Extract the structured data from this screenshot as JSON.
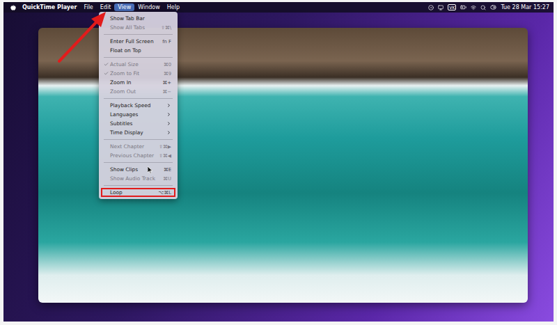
{
  "menubar": {
    "app": "QuickTime Player",
    "menus": [
      {
        "label": "File",
        "selected": false,
        "annotated": false
      },
      {
        "label": "Edit",
        "selected": false,
        "annotated": false
      },
      {
        "label": "View",
        "selected": true,
        "annotated": true
      },
      {
        "label": "Window",
        "selected": false,
        "annotated": false
      },
      {
        "label": "Help",
        "selected": false,
        "annotated": false
      }
    ],
    "input_source": "VK",
    "clock": "Tue 28 Mar 15:27"
  },
  "menu": {
    "items": [
      {
        "kind": "item",
        "label": "Show Tab Bar",
        "shortcut": "",
        "checked": false,
        "disabled": false,
        "submenu": false,
        "annotated": false
      },
      {
        "kind": "item",
        "label": "Show All Tabs",
        "shortcut": "⇧⌘\\",
        "checked": false,
        "disabled": true,
        "submenu": false,
        "annotated": false
      },
      {
        "kind": "separator"
      },
      {
        "kind": "item",
        "label": "Enter Full Screen",
        "shortcut": "fn F",
        "checked": false,
        "disabled": false,
        "submenu": false,
        "annotated": false
      },
      {
        "kind": "item",
        "label": "Float on Top",
        "shortcut": "",
        "checked": false,
        "disabled": false,
        "submenu": false,
        "annotated": false
      },
      {
        "kind": "separator"
      },
      {
        "kind": "item",
        "label": "Actual Size",
        "shortcut": "⌘0",
        "checked": true,
        "disabled": true,
        "submenu": false,
        "annotated": false
      },
      {
        "kind": "item",
        "label": "Zoom to Fit",
        "shortcut": "⌘9",
        "checked": true,
        "disabled": true,
        "submenu": false,
        "annotated": false
      },
      {
        "kind": "item",
        "label": "Zoom In",
        "shortcut": "⌘+",
        "checked": false,
        "disabled": false,
        "submenu": false,
        "annotated": false
      },
      {
        "kind": "item",
        "label": "Zoom Out",
        "shortcut": "⌘−",
        "checked": false,
        "disabled": true,
        "submenu": false,
        "annotated": false
      },
      {
        "kind": "separator"
      },
      {
        "kind": "item",
        "label": "Playback Speed",
        "shortcut": "",
        "checked": false,
        "disabled": false,
        "submenu": true,
        "annotated": false
      },
      {
        "kind": "item",
        "label": "Languages",
        "shortcut": "",
        "checked": false,
        "disabled": false,
        "submenu": true,
        "annotated": false
      },
      {
        "kind": "item",
        "label": "Subtitles",
        "shortcut": "",
        "checked": false,
        "disabled": false,
        "submenu": true,
        "annotated": false
      },
      {
        "kind": "item",
        "label": "Time Display",
        "shortcut": "",
        "checked": false,
        "disabled": false,
        "submenu": true,
        "annotated": false
      },
      {
        "kind": "separator"
      },
      {
        "kind": "item",
        "label": "Next Chapter",
        "shortcut": "⇧⌘▶",
        "checked": false,
        "disabled": true,
        "submenu": false,
        "annotated": false
      },
      {
        "kind": "item",
        "label": "Previous Chapter",
        "shortcut": "⇧⌘◀",
        "checked": false,
        "disabled": true,
        "submenu": false,
        "annotated": false
      },
      {
        "kind": "separator"
      },
      {
        "kind": "item",
        "label": "Show Clips",
        "shortcut": "⌘E",
        "checked": false,
        "disabled": false,
        "submenu": false,
        "annotated": false
      },
      {
        "kind": "item",
        "label": "Show Audio Track",
        "shortcut": "⌘U",
        "checked": false,
        "disabled": true,
        "submenu": false,
        "annotated": false
      },
      {
        "kind": "separator"
      },
      {
        "kind": "item",
        "label": "Loop",
        "shortcut": "⌥⌘L",
        "checked": false,
        "disabled": false,
        "submenu": false,
        "annotated": true
      }
    ]
  }
}
